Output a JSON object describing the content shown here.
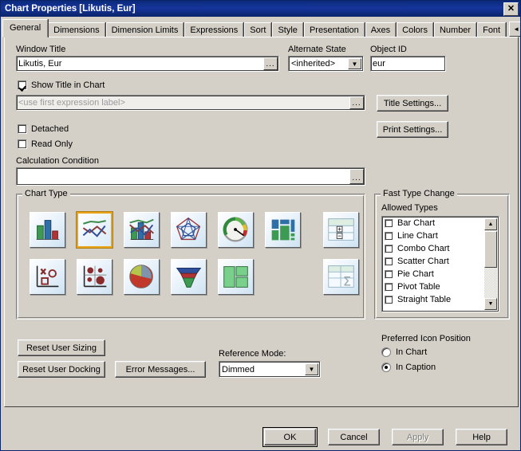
{
  "window": {
    "title": "Chart Properties [Likutis, Eur]",
    "close_label": "✕"
  },
  "tabs": {
    "items": [
      {
        "label": "General",
        "active": true
      },
      {
        "label": "Dimensions",
        "active": false
      },
      {
        "label": "Dimension Limits",
        "active": false
      },
      {
        "label": "Expressions",
        "active": false
      },
      {
        "label": "Sort",
        "active": false
      },
      {
        "label": "Style",
        "active": false
      },
      {
        "label": "Presentation",
        "active": false
      },
      {
        "label": "Axes",
        "active": false
      },
      {
        "label": "Colors",
        "active": false
      },
      {
        "label": "Number",
        "active": false
      },
      {
        "label": "Font",
        "active": false
      }
    ],
    "scroll_left": "◄",
    "scroll_right": "►"
  },
  "general": {
    "window_title_label": "Window Title",
    "window_title_value": "Likutis, Eur",
    "window_title_browse": "...",
    "alternate_state_label": "Alternate State",
    "alternate_state_value": "<inherited>",
    "object_id_label": "Object ID",
    "object_id_value": "eur",
    "show_title_label": "Show Title in Chart",
    "show_title_checked": true,
    "chart_title_placeholder": "<use first expression label>",
    "chart_title_browse": "...",
    "title_settings_label": "Title Settings...",
    "print_settings_label": "Print Settings...",
    "detached_label": "Detached",
    "detached_checked": false,
    "read_only_label": "Read Only",
    "read_only_checked": false,
    "calculation_condition_label": "Calculation Condition",
    "calculation_condition_value": "",
    "calculation_condition_browse": "..."
  },
  "chart_type": {
    "group_label": "Chart Type",
    "icons": [
      {
        "name": "bar-chart",
        "selected": false
      },
      {
        "name": "line-chart",
        "selected": true
      },
      {
        "name": "combo-chart",
        "selected": false
      },
      {
        "name": "radar-chart",
        "selected": false
      },
      {
        "name": "gauge-chart",
        "selected": false
      },
      {
        "name": "block-chart",
        "selected": false
      },
      {
        "name": "pivot-table",
        "selected": false
      },
      {
        "name": "scatter-chart",
        "selected": false
      },
      {
        "name": "grid-chart",
        "selected": false
      },
      {
        "name": "pie-chart",
        "selected": false
      },
      {
        "name": "funnel-chart",
        "selected": false
      },
      {
        "name": "mekko-chart",
        "selected": false
      },
      {
        "name": "straight-table",
        "selected": false
      }
    ]
  },
  "fast_type_change": {
    "group_label": "Fast Type Change",
    "allowed_types_label": "Allowed Types",
    "types": [
      {
        "label": "Bar Chart",
        "checked": false
      },
      {
        "label": "Line Chart",
        "checked": false
      },
      {
        "label": "Combo Chart",
        "checked": false
      },
      {
        "label": "Scatter Chart",
        "checked": false
      },
      {
        "label": "Pie Chart",
        "checked": false
      },
      {
        "label": "Pivot Table",
        "checked": false
      },
      {
        "label": "Straight Table",
        "checked": false
      }
    ],
    "scroll_up": "▲",
    "scroll_down": "▼"
  },
  "icon_position": {
    "label": "Preferred Icon Position",
    "options": [
      {
        "label": "In Chart",
        "selected": false
      },
      {
        "label": "In Caption",
        "selected": true
      }
    ]
  },
  "bottom_controls": {
    "reset_user_sizing": "Reset User Sizing",
    "reset_user_docking": "Reset User Docking",
    "error_messages": "Error Messages...",
    "reference_mode_label": "Reference Mode:",
    "reference_mode_value": "Dimmed",
    "combo_arrow": "▼"
  },
  "footer": {
    "ok": "OK",
    "cancel": "Cancel",
    "apply": "Apply",
    "apply_disabled": true,
    "help": "Help"
  },
  "colors": {
    "titlebar": "#0a246a",
    "face": "#d4d0c8",
    "selected_icon_border": "#e8a317",
    "field_bg": "#ffffff",
    "ghost_text": "#9a9a9a"
  }
}
